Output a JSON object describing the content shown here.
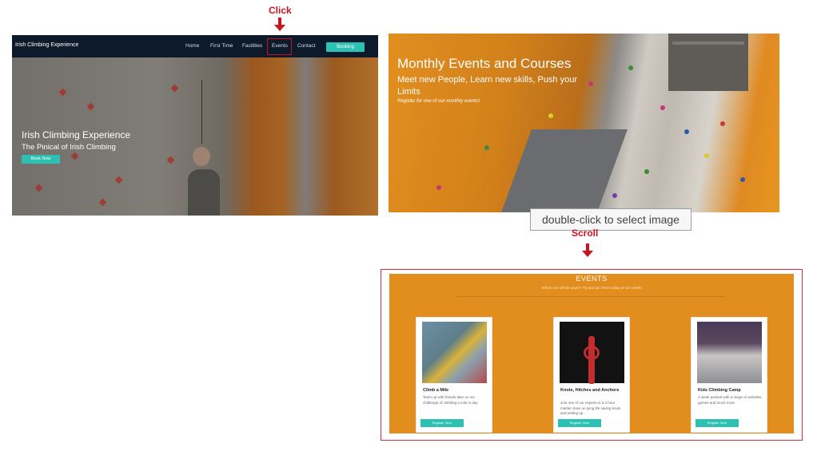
{
  "annotations": {
    "click_label": "Click",
    "scroll_label": "Scroll",
    "tooltip": "double-click to select image"
  },
  "home_page": {
    "brand": "Irish Climbing Experience",
    "nav": [
      "Home",
      "First Time",
      "Facilities",
      "Events",
      "Contact"
    ],
    "booking_button": "Booking",
    "hero_title": "Irish Climbing Experience",
    "hero_subtitle": "The Pinical of Irish Climbing",
    "hero_button": "Book Now"
  },
  "events_hero": {
    "title": "Monthly Events and Courses",
    "subtitle": "Meet new People, Learn new skills, Push your Limits",
    "note": "Register for one of our monthly events!"
  },
  "events_section": {
    "heading": "EVENTS",
    "subheading": "Which one will be yours? Try and join them today at our events",
    "cards": [
      {
        "title": "Climb a Mile",
        "text": "Team up with friends take on our challenge of climbing a mile in day.",
        "button": "Register Here"
      },
      {
        "title": "Knots, Hitches and Anchors",
        "text": "Join one of our experts in a 3 hour master class on tying life saving knots and setting up",
        "button": "Register Here"
      },
      {
        "title": "Kids Climbing Camp",
        "text": "A week packed with a range of activities, games and much more",
        "button": "Register Here"
      }
    ]
  },
  "colors": {
    "accent": "#2cc1b2",
    "annotation_red": "#c8141e",
    "events_orange": "#e28e1f",
    "nav_dark": "#0d1a2b"
  }
}
